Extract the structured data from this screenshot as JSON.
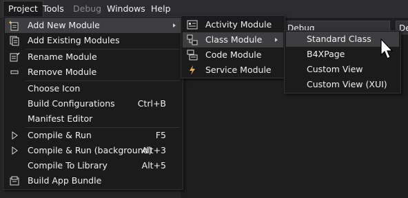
{
  "menubar": {
    "items": [
      {
        "label": "Project",
        "state": "active"
      },
      {
        "label": "Tools",
        "state": "normal"
      },
      {
        "label": "Debug",
        "state": "disabled"
      },
      {
        "label": "Windows",
        "state": "normal"
      },
      {
        "label": "Help",
        "state": "normal"
      }
    ]
  },
  "toolbar": {
    "config_dropdown": "Debug",
    "second_dropdown_partial": "De"
  },
  "project_menu": {
    "items": [
      {
        "label": "Add New Module",
        "icon": "new-module-icon",
        "submenu": true,
        "highlighted": true
      },
      {
        "label": "Add Existing Modules",
        "icon": "existing-modules-icon"
      },
      {
        "label": "Rename Module",
        "icon": "rename-module-icon"
      },
      {
        "label": "Remove Module",
        "icon": "remove-module-icon"
      },
      {
        "label": "Choose Icon"
      },
      {
        "label": "Build Configurations",
        "shortcut": "Ctrl+B"
      },
      {
        "label": "Manifest Editor"
      },
      {
        "label": "Compile & Run",
        "shortcut": "F5",
        "icon": "play-icon"
      },
      {
        "label": "Compile & Run (background)",
        "shortcut": "Alt+3",
        "icon": "play-icon"
      },
      {
        "label": "Compile To Library",
        "shortcut": "Alt+5"
      },
      {
        "label": "Build App Bundle",
        "icon": "bundle-icon"
      }
    ]
  },
  "new_module_menu": {
    "items": [
      {
        "label": "Activity Module",
        "icon": "activity-module-icon"
      },
      {
        "label": "Class Module",
        "icon": "class-module-icon",
        "submenu": true,
        "highlighted": true
      },
      {
        "label": "Code Module",
        "icon": "code-module-icon"
      },
      {
        "label": "Service Module",
        "icon": "lightning-icon"
      }
    ]
  },
  "class_module_menu": {
    "items": [
      {
        "label": "Standard Class",
        "highlighted": true
      },
      {
        "label": "B4XPage"
      },
      {
        "label": "Custom View"
      },
      {
        "label": "Custom View (XUI)"
      }
    ]
  },
  "colors": {
    "menu_bg": "#1b1b1c",
    "highlight": "#3e3e40",
    "text": "#f1f1f1",
    "menubar_bg": "#2d2d30"
  }
}
